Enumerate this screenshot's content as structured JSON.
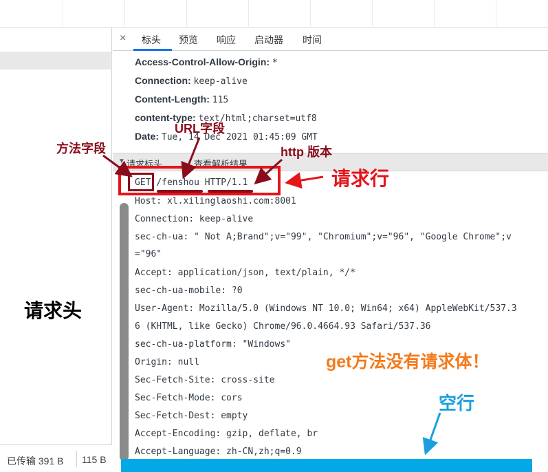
{
  "tabs": {
    "close": "×",
    "items": [
      "标头",
      "预览",
      "响应",
      "启动器",
      "时间"
    ],
    "active": "标头"
  },
  "response_headers": [
    {
      "name": "Access-Control-Allow-Origin:",
      "value": "*"
    },
    {
      "name": "Connection:",
      "value": "keep-alive"
    },
    {
      "name": "Content-Length:",
      "value": "115"
    },
    {
      "name": "content-type:",
      "value": "text/html;charset=utf8"
    },
    {
      "name": "Date:",
      "value": "Tue, 14 Dec 2021 01:45:09 GMT"
    }
  ],
  "section": {
    "title": "请求标头",
    "action": "查看解析结果"
  },
  "request_line": {
    "method": "GET",
    "path": "/fenshou",
    "version": "HTTP/1.1"
  },
  "raw_lines": [
    "Host: xl.xilinglaoshi.com:8001",
    "Connection: keep-alive",
    "sec-ch-ua: \" Not A;Brand\";v=\"99\", \"Chromium\";v=\"96\", \"Google Chrome\";v",
    "=\"96\"",
    "Accept: application/json, text/plain, */*",
    "sec-ch-ua-mobile: ?0",
    "User-Agent: Mozilla/5.0 (Windows NT 10.0; Win64; x64) AppleWebKit/537.3",
    "6 (KHTML, like Gecko) Chrome/96.0.4664.93 Safari/537.36",
    "sec-ch-ua-platform: \"Windows\"",
    "Origin: null",
    "Sec-Fetch-Site: cross-site",
    "Sec-Fetch-Mode: cors",
    "Sec-Fetch-Dest: empty",
    "Accept-Encoding: gzip, deflate, br",
    "Accept-Language: zh-CN,zh;q=0.9"
  ],
  "status": {
    "transferred": "已传输 391 B",
    "size": "115 B"
  },
  "annotations": {
    "method_field": "方法字段",
    "url_field": "URL字段",
    "http_version": "http 版本",
    "request_line": "请求行",
    "request_header": "请求头",
    "no_body": "get方法没有请求体！",
    "empty_line": "空行"
  },
  "colors": {
    "red": "#e5141b",
    "dark_red": "#8b0d1c",
    "orange": "#f47a1c",
    "blue": "#1a9fe0",
    "blue_bar": "#03a9e6"
  }
}
